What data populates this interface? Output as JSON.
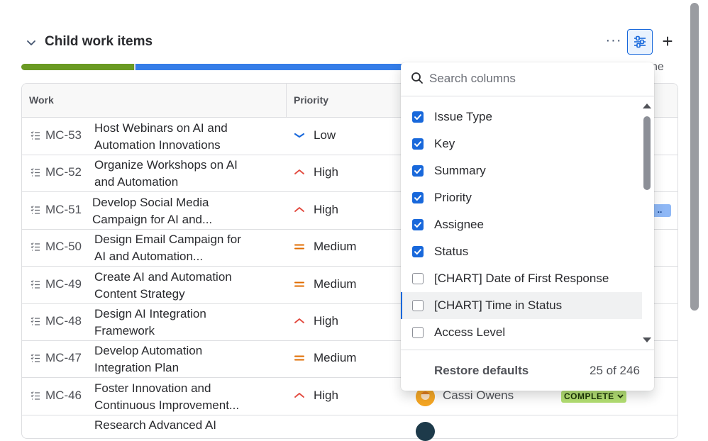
{
  "header": {
    "title": "Child work items",
    "more_label": "···",
    "add_label": "+",
    "right_partial": "ne"
  },
  "progress": {
    "done_fraction": 0.295,
    "in_progress_fraction": 0.705
  },
  "table": {
    "columns": [
      "Work",
      "Priority"
    ],
    "rows": [
      {
        "key": "MC-53",
        "summary_1": "Host Webinars on AI and",
        "summary_2": "Automation Innovations",
        "priority": "Low",
        "priority_icon": "chevron-down-icon"
      },
      {
        "key": "MC-52",
        "summary_1": "Organize Workshops on AI",
        "summary_2": "and Automation",
        "priority": "High",
        "priority_icon": "chevron-up-icon"
      },
      {
        "key": "MC-51",
        "summary_1": "Develop Social Media",
        "summary_2": "Campaign for AI and...",
        "priority": "High",
        "priority_icon": "chevron-up-icon"
      },
      {
        "key": "MC-50",
        "summary_1": "Design Email Campaign for",
        "summary_2": "AI and Automation...",
        "priority": "Medium",
        "priority_icon": "equals-icon"
      },
      {
        "key": "MC-49",
        "summary_1": "Create AI and Automation",
        "summary_2": "Content Strategy",
        "priority": "Medium",
        "priority_icon": "equals-icon"
      },
      {
        "key": "MC-48",
        "summary_1": "Design AI Integration",
        "summary_2": "Framework",
        "priority": "High",
        "priority_icon": "chevron-up-icon"
      },
      {
        "key": "MC-47",
        "summary_1": "Develop Automation",
        "summary_2": "Integration Plan",
        "priority": "Medium",
        "priority_icon": "equals-icon"
      },
      {
        "key": "MC-46",
        "summary_1": "Foster Innovation and",
        "summary_2": "Continuous Improvement...",
        "priority": "High",
        "priority_icon": "chevron-up-icon",
        "assignee": "Cassi Owens",
        "status": "COMPLETE"
      },
      {
        "key": "",
        "summary_1": "Research Advanced AI",
        "summary_2": "",
        "priority": "",
        "priority_icon": ""
      }
    ],
    "partial_status_label": ".."
  },
  "column_picker": {
    "search_placeholder": "Search columns",
    "options": [
      {
        "label": "Issue Type",
        "checked": true
      },
      {
        "label": "Key",
        "checked": true
      },
      {
        "label": "Summary",
        "checked": true
      },
      {
        "label": "Priority",
        "checked": true
      },
      {
        "label": "Assignee",
        "checked": true
      },
      {
        "label": "Status",
        "checked": true
      },
      {
        "label": "[CHART] Date of First Response",
        "checked": false
      },
      {
        "label": "[CHART] Time in Status",
        "checked": false,
        "highlighted": true
      },
      {
        "label": "Access Level",
        "checked": false
      }
    ],
    "restore_label": "Restore defaults",
    "count_label": "25 of 246"
  },
  "colors": {
    "accent": "#1868db",
    "done": "#6a9a23",
    "in_progress": "#357de8",
    "priority_high": "#e2483d",
    "priority_medium": "#e06c00",
    "priority_low": "#1868db",
    "status_complete_bg": "#b3df72"
  }
}
